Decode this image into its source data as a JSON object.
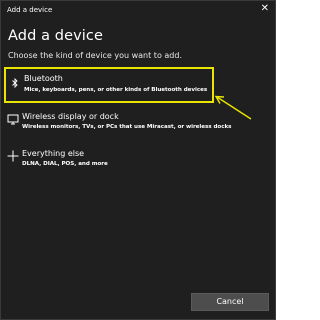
{
  "window": {
    "title": "Add a device",
    "close_glyph": "✕"
  },
  "heading": "Add a device",
  "subtitle": "Choose the kind of device you want to add.",
  "options": [
    {
      "label": "Bluetooth",
      "description": "Mice, keyboards, pens, or other kinds of Bluetooth devices",
      "icon": "bluetooth-icon",
      "selected": true
    },
    {
      "label": "Wireless display or dock",
      "description": "Wireless monitors, TVs, or PCs that use Miracast, or wireless docks",
      "icon": "monitor-icon",
      "selected": false
    },
    {
      "label": "Everything else",
      "description": "DLNA, DIAL, POS, and more",
      "icon": "plus-icon",
      "selected": false
    }
  ],
  "cancel_label": "Cancel",
  "colors": {
    "background": "#1f1f1f",
    "highlight": "#e9e500",
    "button": "#4d4d4d",
    "text": "#ffffff"
  }
}
